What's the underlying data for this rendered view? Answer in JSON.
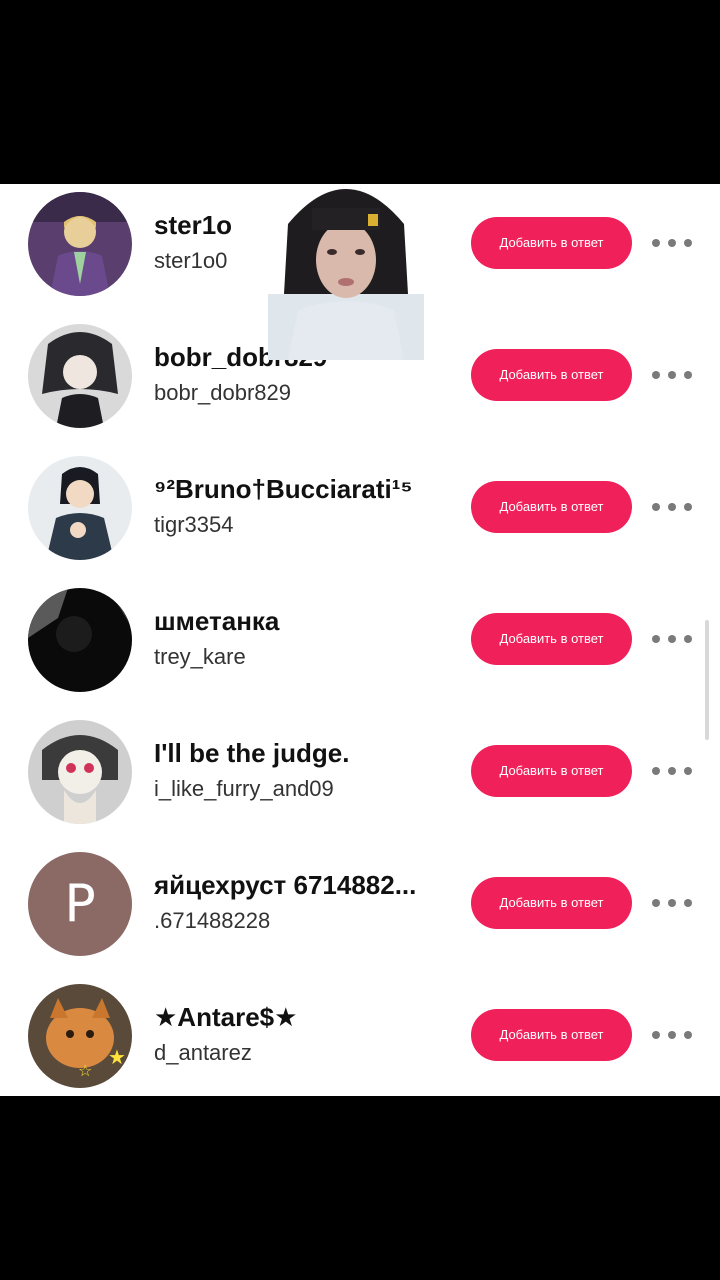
{
  "add_button_label": "Добавить в ответ",
  "colors": {
    "accent": "#f0215a",
    "background": "#ffffff",
    "frame": "#000000"
  },
  "users": [
    {
      "name": "ster1o",
      "handle": "ster1o0",
      "avatar": "anime-avatar-purple"
    },
    {
      "name": "bobr_dobr829",
      "handle": "bobr_dobr829",
      "avatar": "anime-avatar-dark-hair"
    },
    {
      "name": "⁹²Bruno†Bucciarati¹⁵",
      "handle": "tigr3354",
      "avatar": "anime-avatar-bruno"
    },
    {
      "name": "шметанка",
      "handle": "trey_kare",
      "avatar": "dark-photo-avatar"
    },
    {
      "name": "I'll be the judge.",
      "handle": "i_like_furry_and09",
      "avatar": "anime-avatar-masked"
    },
    {
      "name": "яйцехруст 6714882...",
      "handle": ".671488228",
      "avatar": "letter-avatar",
      "avatar_letter": "P"
    },
    {
      "name": "★Antare$★",
      "handle": "d_antarez",
      "avatar": "cat-avatar"
    }
  ]
}
